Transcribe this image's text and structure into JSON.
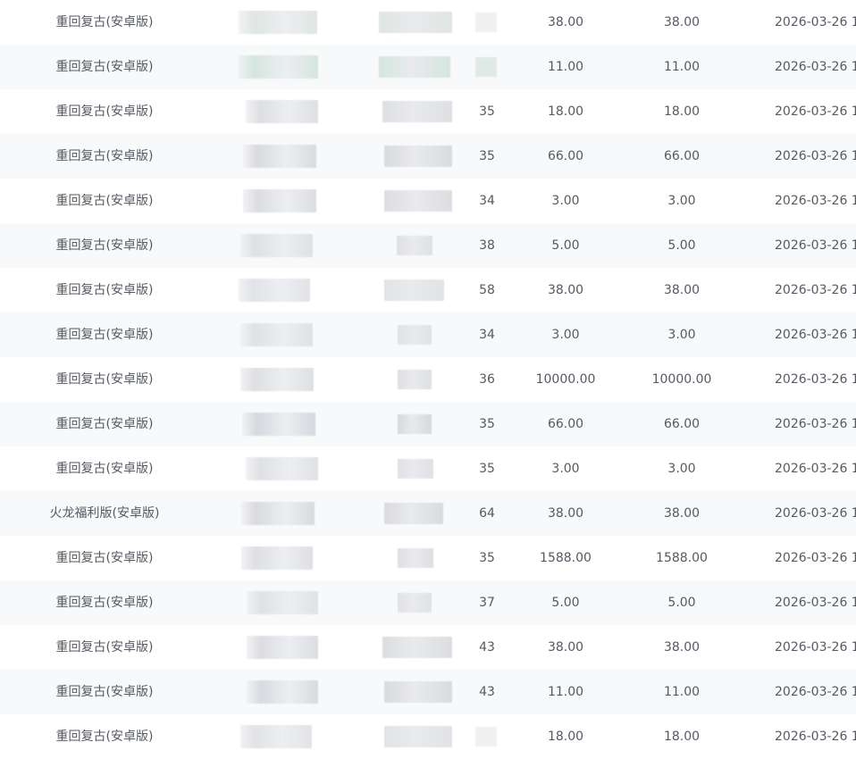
{
  "table": {
    "rows": [
      {
        "game": "重回复古(安卓版)",
        "count": "",
        "amount": "38.00",
        "paid": "38.00",
        "date": "2026-03-26 1",
        "tint": "#dfe6e3"
      },
      {
        "game": "重回复古(安卓版)",
        "count": "",
        "amount": "11.00",
        "paid": "11.00",
        "date": "2026-03-26 1",
        "tint": "#d4e6de"
      },
      {
        "game": "重回复古(安卓版)",
        "count": "35",
        "amount": "18.00",
        "paid": "18.00",
        "date": "2026-03-26 1",
        "tint": "#dedfe3"
      },
      {
        "game": "重回复古(安卓版)",
        "count": "35",
        "amount": "66.00",
        "paid": "66.00",
        "date": "2026-03-26 1",
        "tint": "#d9dadf"
      },
      {
        "game": "重回复古(安卓版)",
        "count": "34",
        "amount": "3.00",
        "paid": "3.00",
        "date": "2026-03-26 1",
        "tint": "#dcdde1"
      },
      {
        "game": "重回复古(安卓版)",
        "count": "38",
        "amount": "5.00",
        "paid": "5.00",
        "date": "2026-03-26 1",
        "tint": "#dfe0e5"
      },
      {
        "game": "重回复古(安卓版)",
        "count": "58",
        "amount": "38.00",
        "paid": "38.00",
        "date": "2026-03-26 1",
        "tint": "#e2e3e7"
      },
      {
        "game": "重回复古(安卓版)",
        "count": "34",
        "amount": "3.00",
        "paid": "3.00",
        "date": "2026-03-26 1",
        "tint": "#e0e1e5"
      },
      {
        "game": "重回复古(安卓版)",
        "count": "36",
        "amount": "10000.00",
        "paid": "10000.00",
        "date": "2026-03-26 1",
        "tint": "#dedfe3"
      },
      {
        "game": "重回复古(安卓版)",
        "count": "35",
        "amount": "66.00",
        "paid": "66.00",
        "date": "2026-03-26 1",
        "tint": "#d6d8df"
      },
      {
        "game": "重回复古(安卓版)",
        "count": "35",
        "amount": "3.00",
        "paid": "3.00",
        "date": "2026-03-26 1",
        "tint": "#e0e1e5"
      },
      {
        "game": "火龙福利版(安卓版)",
        "count": "64",
        "amount": "38.00",
        "paid": "38.00",
        "date": "2026-03-26 1",
        "tint": "#d9dadf"
      },
      {
        "game": "重回复古(安卓版)",
        "count": "35",
        "amount": "1588.00",
        "paid": "1588.00",
        "date": "2026-03-26 1",
        "tint": "#dedfe3"
      },
      {
        "game": "重回复古(安卓版)",
        "count": "37",
        "amount": "5.00",
        "paid": "5.00",
        "date": "2026-03-26 1",
        "tint": "#e1e2e6"
      },
      {
        "game": "重回复古(安卓版)",
        "count": "43",
        "amount": "38.00",
        "paid": "38.00",
        "date": "2026-03-26 1",
        "tint": "#dcdde1"
      },
      {
        "game": "重回复古(安卓版)",
        "count": "43",
        "amount": "11.00",
        "paid": "11.00",
        "date": "2026-03-26 1",
        "tint": "#d9dadf"
      },
      {
        "game": "重回复古(安卓版)",
        "count": "",
        "amount": "18.00",
        "paid": "18.00",
        "date": "2026-03-26 1",
        "tint": "#e2e3e7"
      }
    ]
  },
  "colors": {
    "text": "#555a63",
    "row_alt": "#f7f9fb",
    "redaction": "#e3e4e8"
  }
}
